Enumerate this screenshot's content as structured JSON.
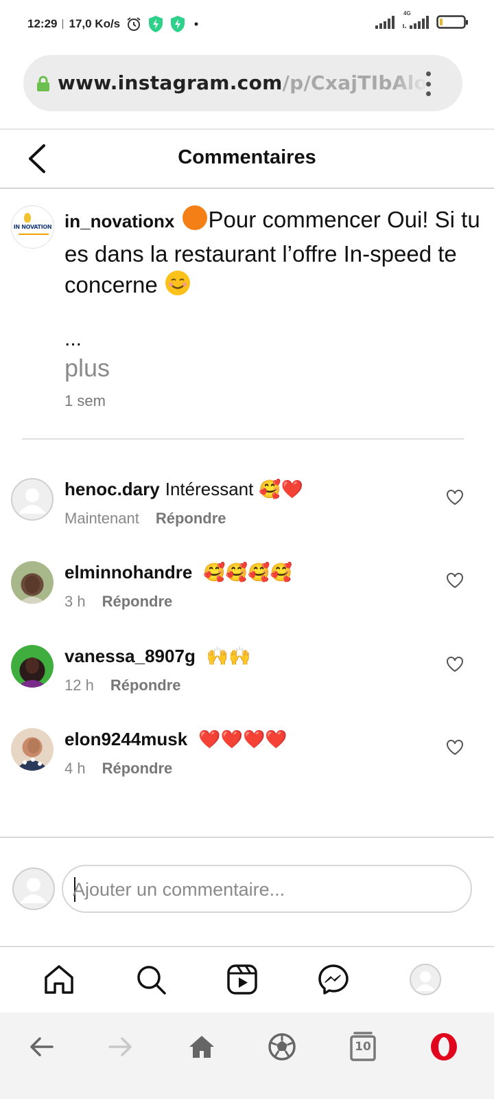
{
  "status_bar": {
    "time": "12:29",
    "speed": "17,0 Ko/s",
    "network_label": "4G",
    "icons": [
      "alarm-icon",
      "shield-icon",
      "shield-icon",
      "dot-icon",
      "signal-icon",
      "signal-icon",
      "battery-icon"
    ]
  },
  "browser": {
    "url_host": "www.instagram.com",
    "url_path": "/p/CxajTIbAloq",
    "tab_count": "10"
  },
  "header": {
    "title": "Commentaires"
  },
  "caption": {
    "username": "in_novationx",
    "text": "Pour commencer Oui! Si tu es dans la restaurant l’offre In-speed te concerne",
    "ellipsis": "...",
    "more_label": "plus",
    "time": "1 sem",
    "avatar_text": "IN NOVATION"
  },
  "comments": [
    {
      "username": "henoc.dary",
      "text": "Intéressant",
      "emojis": "🥰❤️",
      "time": "Maintenant",
      "reply_label": "Répondre"
    },
    {
      "username": "elminnohandre",
      "text": "",
      "emojis": "🥰🥰🥰🥰",
      "time": "3 h",
      "reply_label": "Répondre"
    },
    {
      "username": "vanessa_8907g",
      "text": "",
      "emojis": "🙌🙌",
      "time": "12 h",
      "reply_label": "Répondre"
    },
    {
      "username": "elon9244musk",
      "text": "",
      "emojis": "❤️❤️❤️❤️",
      "time": "4 h",
      "reply_label": "Répondre"
    }
  ],
  "add_comment": {
    "placeholder": "Ajouter un commentaire..."
  },
  "colors": {
    "accent_opera": "#e0061e",
    "lock_green": "#6bbf4e",
    "shield_green": "#2fd08a",
    "muted_text": "#888888"
  }
}
